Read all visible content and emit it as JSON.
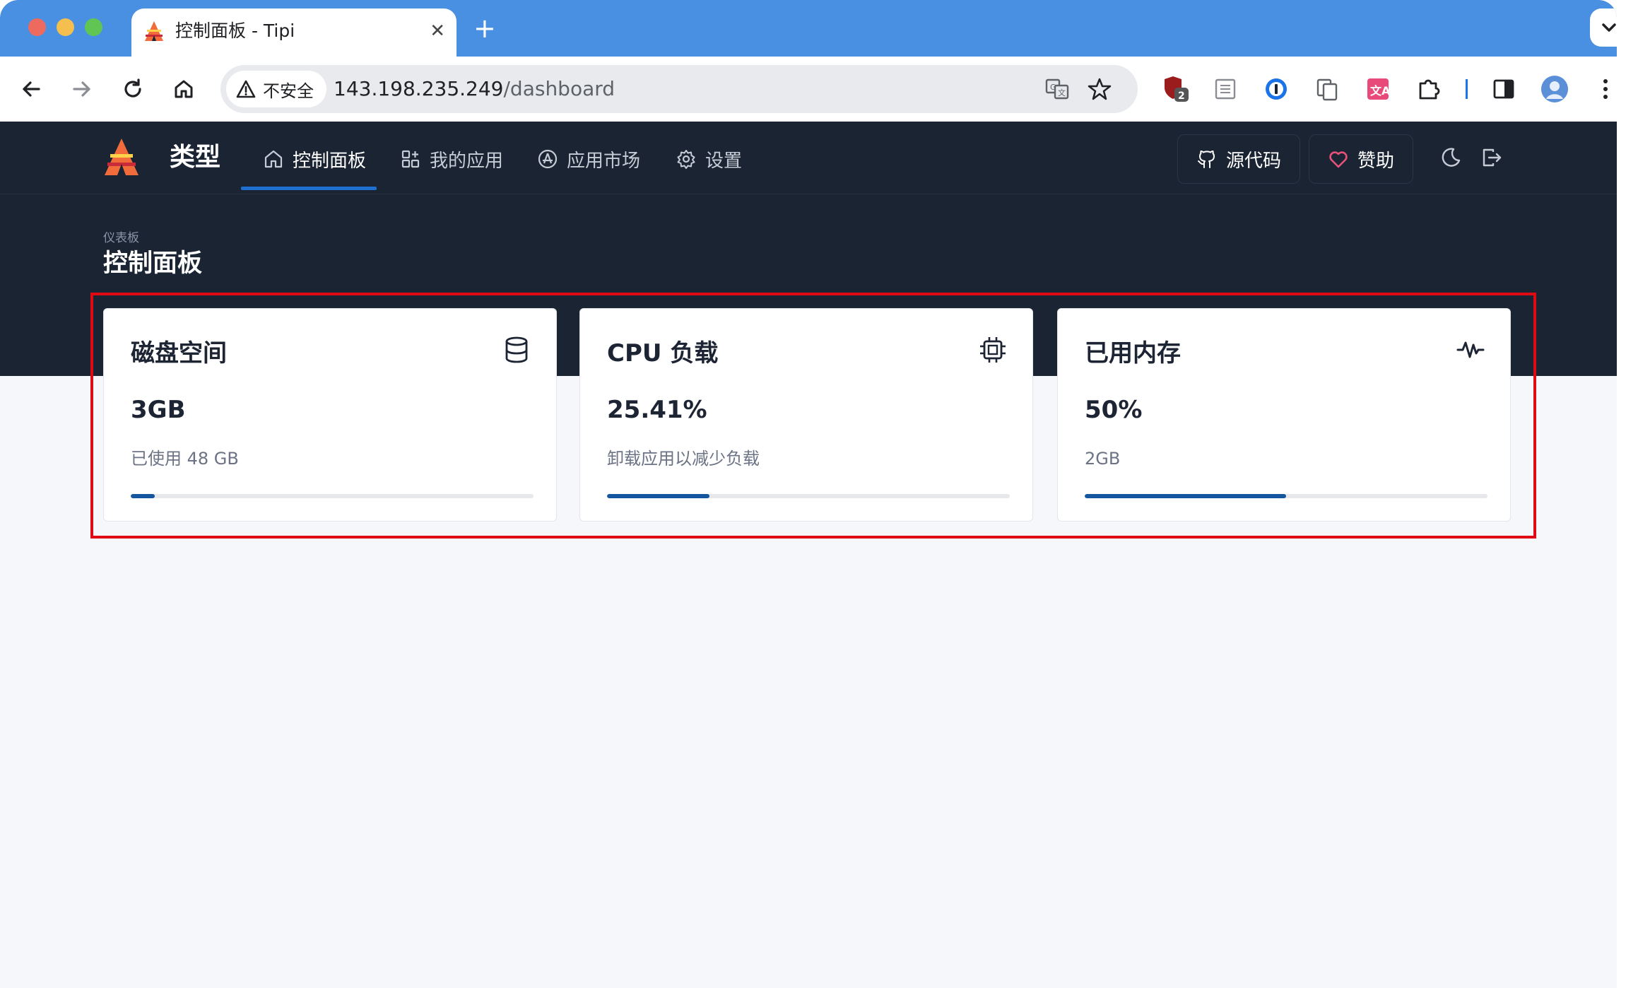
{
  "browser": {
    "tab_title": "控制面板 - Tipi",
    "close_glyph": "✕",
    "new_tab_glyph": "+",
    "security_label": "不安全",
    "url_host": "143.198.235.249",
    "url_path": "/dashboard",
    "extension_badge": "2"
  },
  "app": {
    "brand_name": "类型",
    "nav": [
      {
        "label": "控制面板",
        "icon": "home-icon",
        "active": true
      },
      {
        "label": "我的应用",
        "icon": "apps-icon",
        "active": false
      },
      {
        "label": "应用市场",
        "icon": "app-store-icon",
        "active": false
      },
      {
        "label": "设置",
        "icon": "settings-icon",
        "active": false
      }
    ],
    "source_button": "源代码",
    "sponsor_button": "赞助",
    "pretitle": "仪表板",
    "page_title": "控制面板"
  },
  "cards": [
    {
      "title": "磁盘空间",
      "value": "3GB",
      "subtitle": "已使用 48 GB",
      "progress_percent": 6,
      "icon": "database-icon"
    },
    {
      "title": "CPU 负载",
      "value": "25.41%",
      "subtitle": "卸载应用以减少负载",
      "progress_percent": 25.41,
      "icon": "cpu-icon"
    },
    {
      "title": "已用内存",
      "value": "50%",
      "subtitle": "2GB",
      "progress_percent": 50,
      "icon": "activity-icon"
    }
  ],
  "colors": {
    "browser_accent": "#4a90e2",
    "app_header": "#1b2433",
    "progress": "#14579e",
    "highlight": "#e00a14",
    "sponsor_heart": "#e8527a"
  }
}
